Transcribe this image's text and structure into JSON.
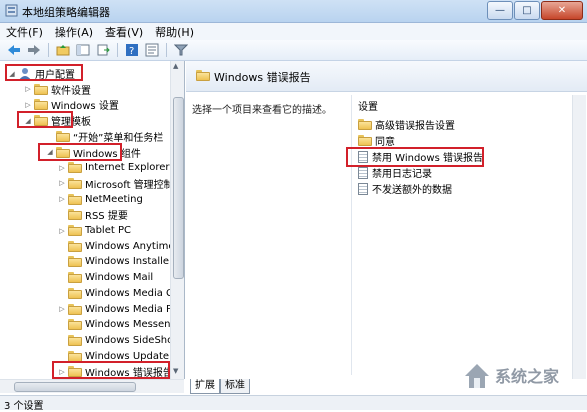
{
  "window": {
    "title": "本地组策略编辑器",
    "buttons": {
      "minimize": "—",
      "maximize": "□",
      "close": "✕"
    }
  },
  "menu": [
    "文件(F)",
    "操作(A)",
    "查看(V)",
    "帮助(H)"
  ],
  "toolbar": [
    "back-icon",
    "forward-icon",
    "folder-up-icon",
    "console-tree-icon",
    "export-icon",
    "help-icon",
    "properties-icon",
    "filter-icon"
  ],
  "tree": [
    {
      "label": "用户配置",
      "level": 0,
      "exp": "◢",
      "icon": "user"
    },
    {
      "label": "软件设置",
      "level": 1,
      "exp": "▷",
      "icon": "folder"
    },
    {
      "label": "Windows 设置",
      "level": 1,
      "exp": "▷",
      "icon": "folder"
    },
    {
      "label": "管理模板",
      "level": 1,
      "exp": "◢",
      "icon": "folder"
    },
    {
      "label": "“开始”菜单和任务栏",
      "level": 2,
      "exp": "",
      "icon": "folder"
    },
    {
      "label": "Windows 组件",
      "level": 2,
      "exp": "◢",
      "icon": "folder"
    },
    {
      "label": "Internet Explorer",
      "level": 3,
      "exp": "▷",
      "icon": "folder"
    },
    {
      "label": "Microsoft 管理控制",
      "level": 3,
      "exp": "▷",
      "icon": "folder"
    },
    {
      "label": "NetMeeting",
      "level": 3,
      "exp": "▷",
      "icon": "folder"
    },
    {
      "label": "RSS 提要",
      "level": 3,
      "exp": "",
      "icon": "folder"
    },
    {
      "label": "Tablet PC",
      "level": 3,
      "exp": "▷",
      "icon": "folder"
    },
    {
      "label": "Windows Anytime U",
      "level": 3,
      "exp": "",
      "icon": "folder"
    },
    {
      "label": "Windows Installer",
      "level": 3,
      "exp": "",
      "icon": "folder"
    },
    {
      "label": "Windows Mail",
      "level": 3,
      "exp": "",
      "icon": "folder"
    },
    {
      "label": "Windows Media Ce",
      "level": 3,
      "exp": "",
      "icon": "folder"
    },
    {
      "label": "Windows Media Pla",
      "level": 3,
      "exp": "▷",
      "icon": "folder"
    },
    {
      "label": "Windows Messeng",
      "level": 3,
      "exp": "",
      "icon": "folder"
    },
    {
      "label": "Windows SideShow",
      "level": 3,
      "exp": "",
      "icon": "folder"
    },
    {
      "label": "Windows Update",
      "level": 3,
      "exp": "",
      "icon": "folder"
    },
    {
      "label": "Windows 错误报告",
      "level": 3,
      "exp": "▷",
      "icon": "folder"
    }
  ],
  "right": {
    "header_title": "Windows 错误报告",
    "description": "选择一个项目来查看它的描述。",
    "column_header": "设置",
    "items": [
      {
        "label": "高级错误报告设置",
        "icon": "folder"
      },
      {
        "label": "同意",
        "icon": "folder"
      },
      {
        "label": "禁用 Windows 错误报告",
        "icon": "page"
      },
      {
        "label": "禁用日志记录",
        "icon": "page"
      },
      {
        "label": "不发送额外的数据",
        "icon": "page"
      }
    ]
  },
  "tabs": [
    "扩展",
    "标准"
  ],
  "status": "3 个设置",
  "watermark": "系统之家"
}
